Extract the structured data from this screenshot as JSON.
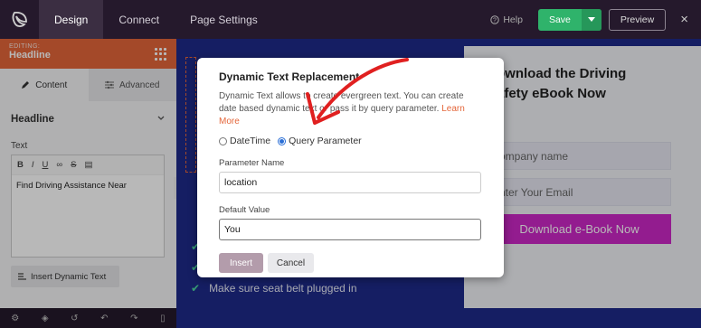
{
  "topbar": {
    "tabs": [
      {
        "label": "Design",
        "active": true
      },
      {
        "label": "Connect",
        "active": false
      },
      {
        "label": "Page Settings",
        "active": false
      }
    ],
    "help_label": "Help",
    "save_label": "Save",
    "preview_label": "Preview",
    "close_icon": "×"
  },
  "sidebar": {
    "editing_label": "EDITING:",
    "element_name": "Headline",
    "tabs": [
      {
        "label": "Content",
        "icon": "pencil-icon",
        "active": true
      },
      {
        "label": "Advanced",
        "icon": "sliders-icon",
        "active": false
      }
    ],
    "section_title": "Headline",
    "text_label": "Text",
    "editor_toolbar": [
      "B",
      "I",
      "U",
      "∞",
      "S",
      "▤"
    ],
    "editor_text": "Find Driving Assistance Near",
    "insert_dynamic_label": "Insert Dynamic Text",
    "footer_icons": [
      "settings-icon",
      "layers-icon",
      "history-icon",
      "undo-icon",
      "redo-icon",
      "mobile-icon"
    ]
  },
  "canvas": {
    "bullet_items": [
      "",
      "",
      "Make sure seat belt plugged in"
    ],
    "form": {
      "title_line1": "ownload the Driving",
      "title_line2": "afety eBook Now",
      "input1_placeholder": "ompany name",
      "input2_placeholder": "nter Your Email",
      "button_label": "Download e-Book Now"
    }
  },
  "modal": {
    "title": "Dynamic Text Replacement",
    "desc_part1": "Dynamic Text allows to create evergreen text. You can create date based dynamic text or pass it by query parameter.",
    "learn_more": "Learn More",
    "radio_datetime": "DateTime",
    "radio_query": "Query Parameter",
    "selected": "Query Parameter",
    "param_label": "Parameter Name",
    "param_value": "location",
    "default_label": "Default Value",
    "default_value": "You",
    "insert_label": "Insert",
    "cancel_label": "Cancel"
  },
  "colors": {
    "accent": "#e4663a",
    "save_green": "#2fb36b",
    "download_magenta": "#cc27c7",
    "arrow_red": "#e02020"
  }
}
